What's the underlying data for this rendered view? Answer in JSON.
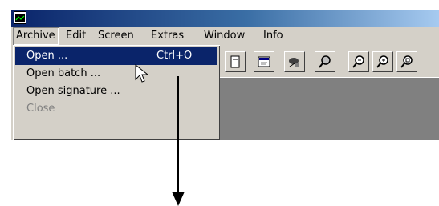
{
  "menubar": {
    "items": [
      {
        "label": "Archive",
        "active": true
      },
      {
        "label": "Edit"
      },
      {
        "label": "Screen"
      },
      {
        "label": "Extras"
      },
      {
        "label": "Window"
      },
      {
        "label": "Info"
      }
    ]
  },
  "archive_menu": {
    "items": [
      {
        "label": "Open ...",
        "shortcut": "Ctrl+O",
        "highlighted": true
      },
      {
        "label": "Open batch ..."
      },
      {
        "label": "Open signature ..."
      },
      {
        "label": "Close",
        "disabled": true
      }
    ]
  },
  "toolbar": {
    "icons": [
      "page-icon",
      "properties-icon",
      "signature-icon",
      "magnifier-icon",
      "zoom-in-icon",
      "zoom-out-icon",
      "zoom-fit-icon"
    ]
  },
  "colors": {
    "titlebar_start": "#0a246a",
    "titlebar_end": "#a6caf0",
    "highlight": "#0a246a",
    "face": "#d4d0c8",
    "workspace": "#808080"
  }
}
